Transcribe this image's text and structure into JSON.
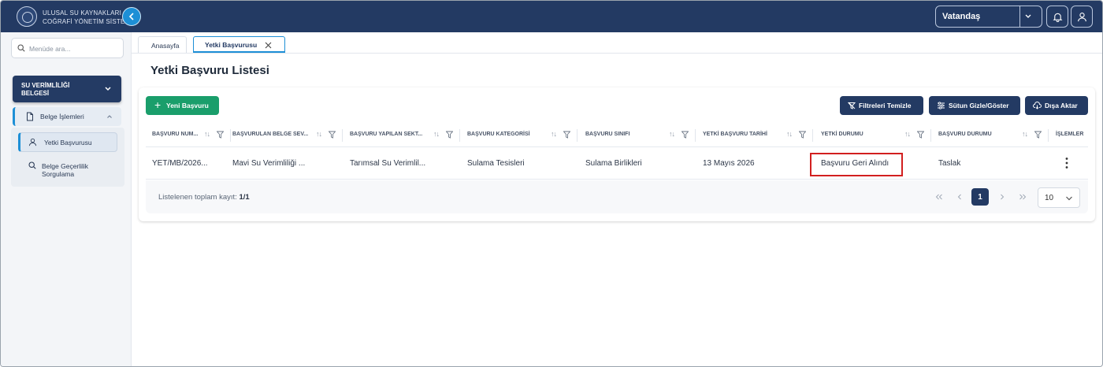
{
  "header": {
    "app_title_line1": "ULUSAL SU KAYNAKLARI",
    "app_title_line2": "COĞRAFİ YÖNETİM SİSTEMİ",
    "role": "Vatandaş",
    "icons": [
      "chevron-left-icon",
      "chevron-down-icon",
      "bell-icon",
      "user-icon"
    ]
  },
  "sidebar": {
    "search_placeholder": "Menüde ara...",
    "group_label": "SU VERİMLİLİĞİ BELGESİ",
    "submenu_label": "Belge İşlemleri",
    "items": [
      {
        "label": "Yetki Başvurusu",
        "active": true
      },
      {
        "label": "Belge Geçerlilik Sorgulama",
        "active": false
      }
    ]
  },
  "tabs": [
    {
      "label": "Anasayfa"
    },
    {
      "label": "Yetki Başvurusu",
      "active": true
    }
  ],
  "main": {
    "title": "Yetki Başvuru Listesi",
    "new_button": "Yeni Başvuru",
    "actions": {
      "clear_filters": "Filtreleri Temizle",
      "toggle_columns": "Sütun Gizle/Göster",
      "export": "Dışa Aktar"
    },
    "columns": [
      "BAŞVURU NUM...",
      "BAŞVURULAN BELGE SEV...",
      "BAŞVURU YAPILAN SEKT...",
      "BAŞVURU KATEGORİSİ",
      "BAŞVURU SINIFI",
      "YETKİ BAŞVURU TARİHİ",
      "YETKİ DURUMU",
      "BAŞVURU DURUMU",
      "İŞLEMLER"
    ],
    "rows": [
      [
        "YET/MB/2026...",
        "Mavi Su Verimliliği ...",
        "Tarımsal Su Verimlil...",
        "Sulama Tesisleri",
        "Sulama Birlikleri",
        "13 Mayıs 2026",
        "Başvuru Geri Alındı",
        "Taslak"
      ]
    ],
    "footer": {
      "total_label": "Listelenen toplam kayıt:",
      "total_value": "1/1",
      "current_page": "1",
      "page_size": "10"
    }
  },
  "colors": {
    "header_bg": "#233a63",
    "accent_blue": "#1d8fd6",
    "primary_green": "#1a9e6b",
    "highlight_red": "#d21f1f"
  }
}
